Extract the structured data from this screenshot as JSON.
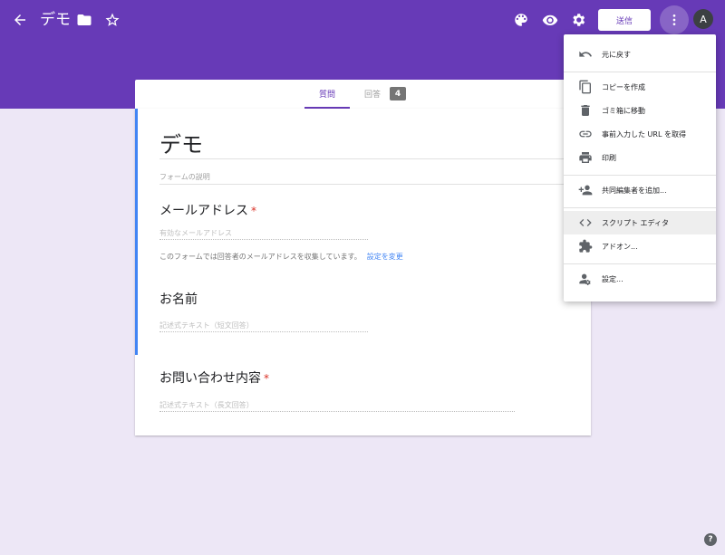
{
  "header": {
    "title": "デモ",
    "send_label": "送信",
    "avatar_letter": "A",
    "colors": {
      "bar": "#673ab7",
      "background": "#ede7f6"
    }
  },
  "tabs": {
    "questions": "質問",
    "responses": "回答",
    "response_count": "4"
  },
  "form": {
    "title": "デモ",
    "description_placeholder": "フォームの説明",
    "email_label": "メールアドレス",
    "email_placeholder": "有効なメールアドレス",
    "email_notice": "このフォームでは回答者のメールアドレスを収集しています。",
    "change_settings": "設定を変更",
    "name_label": "お名前",
    "name_placeholder": "記述式テキスト（短文回答）",
    "inquiry_label": "お問い合わせ内容",
    "inquiry_placeholder": "記述式テキスト（長文回答）",
    "required_mark": "*"
  },
  "menu": {
    "items": [
      {
        "label": "元に戻す",
        "icon": "undo-icon"
      },
      {
        "label": "コピーを作成",
        "icon": "copy-icon"
      },
      {
        "label": "ゴミ箱に移動",
        "icon": "trash-icon"
      },
      {
        "label": "事前入力した URL を取得",
        "icon": "link-icon"
      },
      {
        "label": "印刷",
        "icon": "print-icon"
      },
      {
        "label": "共同編集者を追加...",
        "icon": "add-person-icon"
      },
      {
        "label": "スクリプト エディタ",
        "icon": "code-icon"
      },
      {
        "label": "アドオン...",
        "icon": "puzzle-icon"
      },
      {
        "label": "設定...",
        "icon": "person-settings-icon"
      }
    ]
  },
  "help_glyph": "?"
}
